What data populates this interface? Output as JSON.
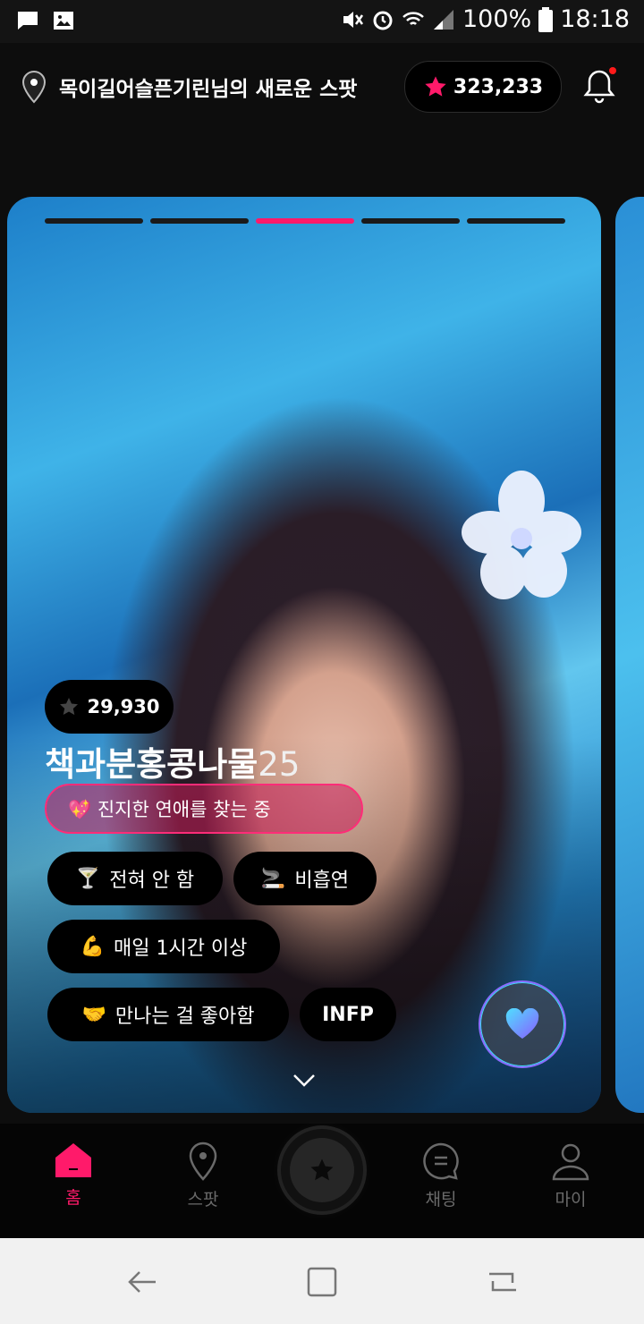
{
  "statusbar": {
    "battery": "100%",
    "time": "18:18"
  },
  "header": {
    "location_title": "목이길어슬픈기린님의 새로운 스팟",
    "points": "323,233"
  },
  "card": {
    "progress_total": 5,
    "progress_active_index": 2,
    "star_count": "29,930",
    "name": "책과분홍콩나물",
    "age": "25",
    "purpose": "💖 진지한 연애를 찾는 중",
    "tags": [
      {
        "emoji": "🍸",
        "label": "전혀 안 함"
      },
      {
        "emoji": "🚬",
        "label": "비흡연"
      },
      {
        "emoji": "💪",
        "label": "매일 1시간 이상"
      },
      {
        "emoji": "🤝",
        "label": "만나는 걸 좋아함"
      },
      {
        "emoji": "",
        "label": "INFP"
      }
    ]
  },
  "nav": {
    "items": [
      {
        "label": "홈"
      },
      {
        "label": "스팟"
      },
      {
        "label": "채팅"
      },
      {
        "label": "마이"
      }
    ]
  },
  "colors": {
    "accent": "#ff1a6a"
  }
}
